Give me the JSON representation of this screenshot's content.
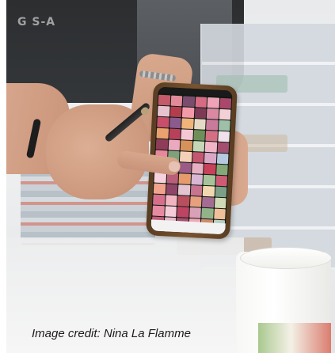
{
  "photo": {
    "subject": "hand pointing at smartphone showing a grid of flower photos",
    "credit_text": "Image credit: Nina La Flamme"
  },
  "shirt_text": "G   S-A",
  "phone": {
    "screen_tile_colors": [
      "#c45a6a",
      "#e08a9a",
      "#7a4c6e",
      "#d66b83",
      "#f0a3b8",
      "#a9486a",
      "#e6c3cf",
      "#b43d4d",
      "#f29aa9",
      "#7d3a55",
      "#d98aa2",
      "#f3d0d6",
      "#c94e6a",
      "#8a5b8c",
      "#f0b37a",
      "#e6d9c6",
      "#c97b9b",
      "#9ec0a8",
      "#e9a16f",
      "#b9405b",
      "#f5c7d4",
      "#6f8f5a",
      "#d46f84",
      "#f0e1ea",
      "#8e3c57",
      "#eba9c0",
      "#d7915a",
      "#c4d8b8",
      "#f1b5c8",
      "#a34f6f",
      "#e8879e",
      "#7fa07a",
      "#f4d0b8",
      "#c35670",
      "#dca7c6",
      "#b6c9e0",
      "#d9647c",
      "#f2c1a4",
      "#9c5a86",
      "#e7b0c2",
      "#c7415a",
      "#86a777",
      "#f6d2de",
      "#b95f79",
      "#e79b6d",
      "#d8b6d4",
      "#a8c39a",
      "#ce5b74",
      "#f0a38d",
      "#8f4567",
      "#e4c4d1",
      "#c87390",
      "#f2d8b0",
      "#7c9f88",
      "#d66e8c",
      "#f3b4c2",
      "#b84f5e",
      "#e6a07e",
      "#a56c93",
      "#cfd9b6",
      "#e58aa1",
      "#f5cdd8",
      "#bd4462",
      "#d9a1b8",
      "#92b38a",
      "#f0c09a",
      "#c25b78",
      "#e8b9cc",
      "#a45070",
      "#f2a7b7",
      "#d1896b",
      "#b7d0c4",
      "#e07a92",
      "#f4e0e6",
      "#b5425e",
      "#dba6c1",
      "#9cb98a",
      "#f1c7a8"
    ]
  }
}
